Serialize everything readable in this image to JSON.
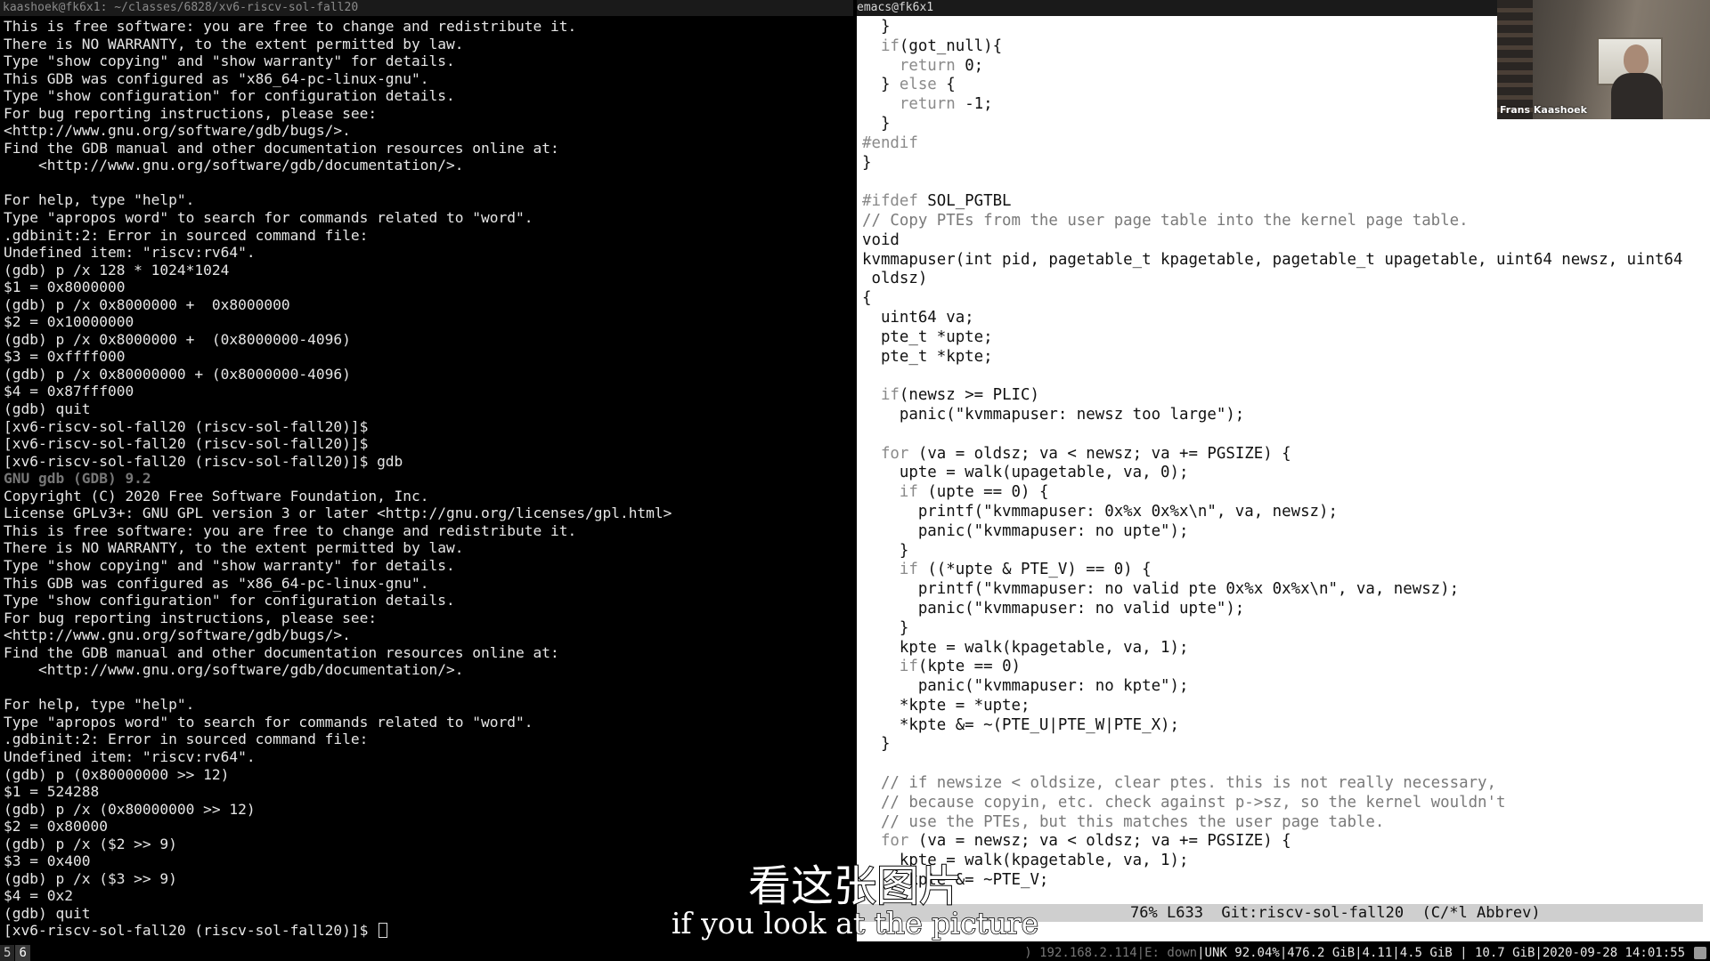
{
  "terminal": {
    "title": "kaashoek@fk6x1: ~/classes/6828/xv6-riscv-sol-fall20",
    "lines": [
      "This is free software: you are free to change and redistribute it.",
      "There is NO WARRANTY, to the extent permitted by law.",
      "Type \"show copying\" and \"show warranty\" for details.",
      "This GDB was configured as \"x86_64-pc-linux-gnu\".",
      "Type \"show configuration\" for configuration details.",
      "For bug reporting instructions, please see:",
      "<http://www.gnu.org/software/gdb/bugs/>.",
      "Find the GDB manual and other documentation resources online at:",
      "    <http://www.gnu.org/software/gdb/documentation/>.",
      "",
      "For help, type \"help\".",
      "Type \"apropos word\" to search for commands related to \"word\".",
      ".gdbinit:2: Error in sourced command file:",
      "Undefined item: \"riscv:rv64\".",
      "(gdb) p /x 128 * 1024*1024",
      "$1 = 0x8000000",
      "(gdb) p /x 0x8000000 +  0x8000000",
      "$2 = 0x10000000",
      "(gdb) p /x 0x8000000 +  (0x8000000-4096)",
      "$3 = 0xffff000",
      "(gdb) p /x 0x80000000 + (0x8000000-4096)",
      "$4 = 0x87fff000",
      "(gdb) quit",
      "[xv6-riscv-sol-fall20 (riscv-sol-fall20)]$",
      "[xv6-riscv-sol-fall20 (riscv-sol-fall20)]$",
      "[xv6-riscv-sol-fall20 (riscv-sol-fall20)]$ gdb",
      "GNU gdb (GDB) 9.2",
      "Copyright (C) 2020 Free Software Foundation, Inc.",
      "License GPLv3+: GNU GPL version 3 or later <http://gnu.org/licenses/gpl.html>",
      "This is free software: you are free to change and redistribute it.",
      "There is NO WARRANTY, to the extent permitted by law.",
      "Type \"show copying\" and \"show warranty\" for details.",
      "This GDB was configured as \"x86_64-pc-linux-gnu\".",
      "Type \"show configuration\" for configuration details.",
      "For bug reporting instructions, please see:",
      "<http://www.gnu.org/software/gdb/bugs/>.",
      "Find the GDB manual and other documentation resources online at:",
      "    <http://www.gnu.org/software/gdb/documentation/>.",
      "",
      "For help, type \"help\".",
      "Type \"apropos word\" to search for commands related to \"word\".",
      ".gdbinit:2: Error in sourced command file:",
      "Undefined item: \"riscv:rv64\".",
      "(gdb) p (0x80000000 >> 12)",
      "$1 = 524288",
      "(gdb) p /x (0x80000000 >> 12)",
      "$2 = 0x80000",
      "(gdb) p /x ($2 >> 9)",
      "$3 = 0x400",
      "(gdb) p /x ($3 >> 9)",
      "$4 = 0x2",
      "(gdb) quit"
    ],
    "highlight_line": "GNU gdb (GDB) 9.2",
    "prompt": "[xv6-riscv-sol-fall20 (riscv-sol-fall20)]$ "
  },
  "emacs": {
    "title": "emacs@fk6x1",
    "code": [
      "  }",
      "  if(got_null){",
      "    return 0;",
      "  } else {",
      "    return -1;",
      "  }",
      "#endif",
      "}",
      "",
      "#ifdef SOL_PGTBL",
      "// Copy PTEs from the user page table into the kernel page table.",
      "void",
      "kvmmapuser(int pid, pagetable_t kpagetable, pagetable_t upagetable, uint64 newsz, uint64 ",
      " oldsz)",
      "{",
      "  uint64 va;",
      "  pte_t *upte;",
      "  pte_t *kpte;",
      "",
      "  if(newsz >= PLIC)",
      "    panic(\"kvmmapuser: newsz too large\");",
      "",
      "  for (va = oldsz; va < newsz; va += PGSIZE) {",
      "    upte = walk(upagetable, va, 0);",
      "    if (upte == 0) {",
      "      printf(\"kvmmapuser: 0x%x 0x%x\\n\", va, newsz);",
      "      panic(\"kvmmapuser: no upte\");",
      "    }",
      "    if ((*upte & PTE_V) == 0) {",
      "      printf(\"kvmmapuser: no valid pte 0x%x 0x%x\\n\", va, newsz);",
      "      panic(\"kvmmapuser: no valid upte\");",
      "    }",
      "    kpte = walk(kpagetable, va, 1);",
      "    if(kpte == 0)",
      "      panic(\"kvmmapuser: no kpte\");",
      "    *kpte = *upte;",
      "    *kpte &= ~(PTE_U|PTE_W|PTE_X);",
      "  }",
      "",
      "  // if newsize < oldsize, clear ptes. this is not really necessary,",
      "  // because copyin, etc. check against p->sz, so the kernel wouldn't",
      "  // use the PTEs, but this matches the user page table.",
      "  for (va = newsz; va < oldsz; va += PGSIZE) {",
      "    kpte = walk(kpagetable, va, 1);",
      "    *kpte &= ~PTE_V;"
    ],
    "modeline": "                              76% L633  Git:riscv-sol-fall20  (C/*l Abbrev)"
  },
  "webcam": {
    "name": "Frans Kaashoek"
  },
  "subtitles": {
    "cn": "看这张图片",
    "en": "if you look at the picture"
  },
  "statusbar": {
    "workspaces": [
      "5",
      "6"
    ],
    "active_workspace": "6",
    "net_dim": ") 192.168.2.114|E: down",
    "stats": "|UNK 92.04%|476.2 GiB|4.11|4.5 GiB | 10.7 GiB|2020-09-28 14:01:55"
  }
}
